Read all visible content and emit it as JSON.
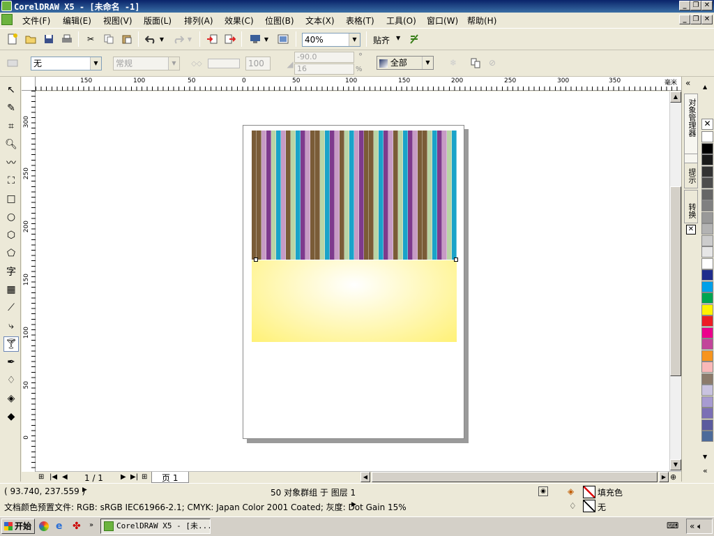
{
  "window": {
    "title": "CorelDRAW X5 - [未命名 -1]"
  },
  "menu": [
    {
      "label": "文件(F)"
    },
    {
      "label": "编辑(E)"
    },
    {
      "label": "视图(V)"
    },
    {
      "label": "版面(L)"
    },
    {
      "label": "排列(A)"
    },
    {
      "label": "效果(C)"
    },
    {
      "label": "位图(B)"
    },
    {
      "label": "文本(X)"
    },
    {
      "label": "表格(T)"
    },
    {
      "label": "工具(O)"
    },
    {
      "label": "窗口(W)"
    },
    {
      "label": "帮助(H)"
    }
  ],
  "toolbar": {
    "zoom_value": "40%",
    "snap_label": "贴齐"
  },
  "propertybar": {
    "outline_value": "无",
    "style_value": "常规",
    "opacity_value": "100",
    "angle_value": "-90.0",
    "edge_value": "16",
    "degree_symbol": "°",
    "percent_symbol": "%",
    "target_value": "全部"
  },
  "ruler": {
    "unit": "毫米",
    "h_ticks": [
      "150",
      "100",
      "50",
      "0",
      "50",
      "100",
      "150",
      "200",
      "250",
      "300",
      "350"
    ],
    "v_ticks": [
      "300",
      "250",
      "200",
      "150",
      "100",
      "50",
      "0"
    ]
  },
  "dockers": {
    "tab1": "对象管理器",
    "tab2": "提示",
    "tab3": "转换"
  },
  "pagenav": {
    "counter": "1 / 1",
    "page_tab": "页 1"
  },
  "status": {
    "coords": "( 93.740, 237.559 )",
    "selection": "50 对象群组 于 图层 1",
    "fill_label": "填充色",
    "outline_label": "无",
    "color_profile": "文档颜色预置文件: RGB: sRGB IEC61966-2.1; CMYK: Japan Color 2001 Coated; 灰度: Dot Gain 15%"
  },
  "taskbar": {
    "start_label": "开始",
    "task_label": "CorelDRAW X5 - [未..."
  },
  "colors": {
    "stripes": [
      "#7a5c37",
      "#c79bc5",
      "#7e3a8d",
      "#b9d5a6",
      "#1aa3c9"
    ],
    "gradient_center": "#ffffff",
    "gradient_edge": "#fff176"
  },
  "palette": [
    "#ffffff",
    "#000000",
    "#1a1a1a",
    "#333333",
    "#4d4d4d",
    "#666666",
    "#808080",
    "#999999",
    "#b3b3b3",
    "#cccccc",
    "#e6e6e6",
    "#ffffff",
    "#1f2c8c",
    "#00a0e9",
    "#00a651",
    "#fff200",
    "#ed1c24",
    "#ec008c",
    "#c2449a",
    "#f7941d",
    "#f9b8b8",
    "#8c7b6b",
    "#c9c3e0",
    "#a79bd1",
    "#7b6fb5",
    "#5b5b9e",
    "#4d6b9a"
  ]
}
